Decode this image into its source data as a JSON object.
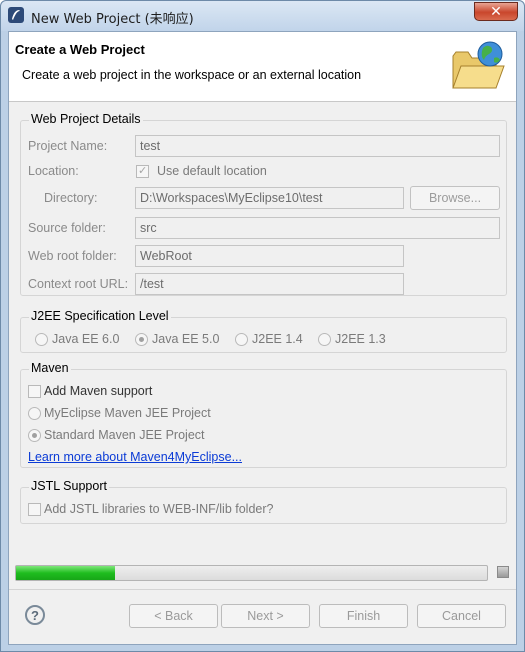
{
  "window": {
    "title": "New Web Project (未响应)",
    "close_symbol": "✕"
  },
  "header": {
    "title": "Create a Web Project",
    "description": "Create a web project in the workspace or an external location",
    "icon": "folder-globe-icon"
  },
  "project_details": {
    "group_title": "Web Project Details",
    "project_name_label": "Project Name:",
    "project_name_value": "test",
    "location_label": "Location:",
    "use_default_label": "Use default location",
    "use_default_checked": true,
    "directory_label": "Directory:",
    "directory_value": "D:\\Workspaces\\MyEclipse10\\test",
    "browse_label": "Browse...",
    "source_folder_label": "Source folder:",
    "source_folder_value": "src",
    "web_root_label": "Web root folder:",
    "web_root_value": "WebRoot",
    "context_root_label": "Context root URL:",
    "context_root_value": "/test"
  },
  "j2ee": {
    "group_title": "J2EE Specification Level",
    "options": [
      "Java EE 6.0",
      "Java EE 5.0",
      "J2EE 1.4",
      "J2EE 1.3"
    ],
    "selected": "Java EE 5.0"
  },
  "maven": {
    "group_title": "Maven",
    "add_support_label": "Add Maven support",
    "option_myeclipse": "MyEclipse Maven JEE Project",
    "option_standard": "Standard Maven JEE Project",
    "selected": "Standard Maven JEE Project",
    "learn_more_link": "Learn more about Maven4MyEclipse..."
  },
  "jstl": {
    "group_title": "JSTL Support",
    "add_jstl_label": "Add JSTL libraries to WEB-INF/lib folder?"
  },
  "progress": {
    "fraction": 0.21,
    "fill_color": "#1fbd1f"
  },
  "footer": {
    "help_symbol": "?",
    "back_label": "< Back",
    "next_label": "Next >",
    "finish_label": "Finish",
    "cancel_label": "Cancel"
  }
}
